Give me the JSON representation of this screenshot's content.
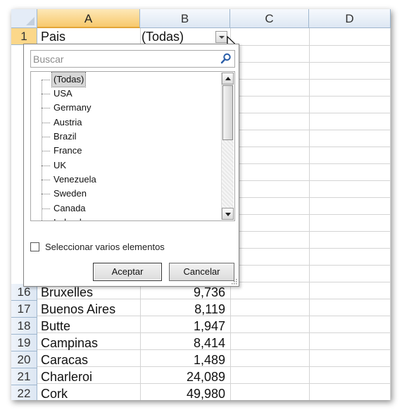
{
  "sheet": {
    "columns": [
      "A",
      "B",
      "C",
      "D"
    ],
    "header_row": {
      "row": "1",
      "a": "Pais",
      "b": "(Todas)"
    },
    "rows": [
      {
        "row": "16",
        "a": "Bruxelles",
        "b": "9,736"
      },
      {
        "row": "17",
        "a": "Buenos Aires",
        "b": "8,119"
      },
      {
        "row": "18",
        "a": "Butte",
        "b": "1,947"
      },
      {
        "row": "19",
        "a": "Campinas",
        "b": "8,414"
      },
      {
        "row": "20",
        "a": "Caracas",
        "b": "1,489"
      },
      {
        "row": "21",
        "a": "Charleroi",
        "b": "24,089"
      },
      {
        "row": "22",
        "a": "Cork",
        "b": "49,980"
      }
    ]
  },
  "filter": {
    "search_placeholder": "Buscar",
    "items": [
      "(Todas)",
      "USA",
      "Germany",
      "Austria",
      "Brazil",
      "France",
      "UK",
      "Venezuela",
      "Sweden",
      "Canada",
      "Ireland"
    ],
    "selected_item": "(Todas)",
    "multi_select_label": "Seleccionar varios elementos",
    "multi_select_checked": false,
    "accept_label": "Aceptar",
    "cancel_label": "Cancelar"
  },
  "icons": {
    "search": "magnifier-icon",
    "dropdown": "chevron-down-icon",
    "cursor": "mouse-pointer-icon"
  },
  "colors": {
    "selected_header": "#f8c96c",
    "header": "#dde7f3",
    "gridline": "#d4d4d4",
    "selection": "#d7d7d7"
  }
}
